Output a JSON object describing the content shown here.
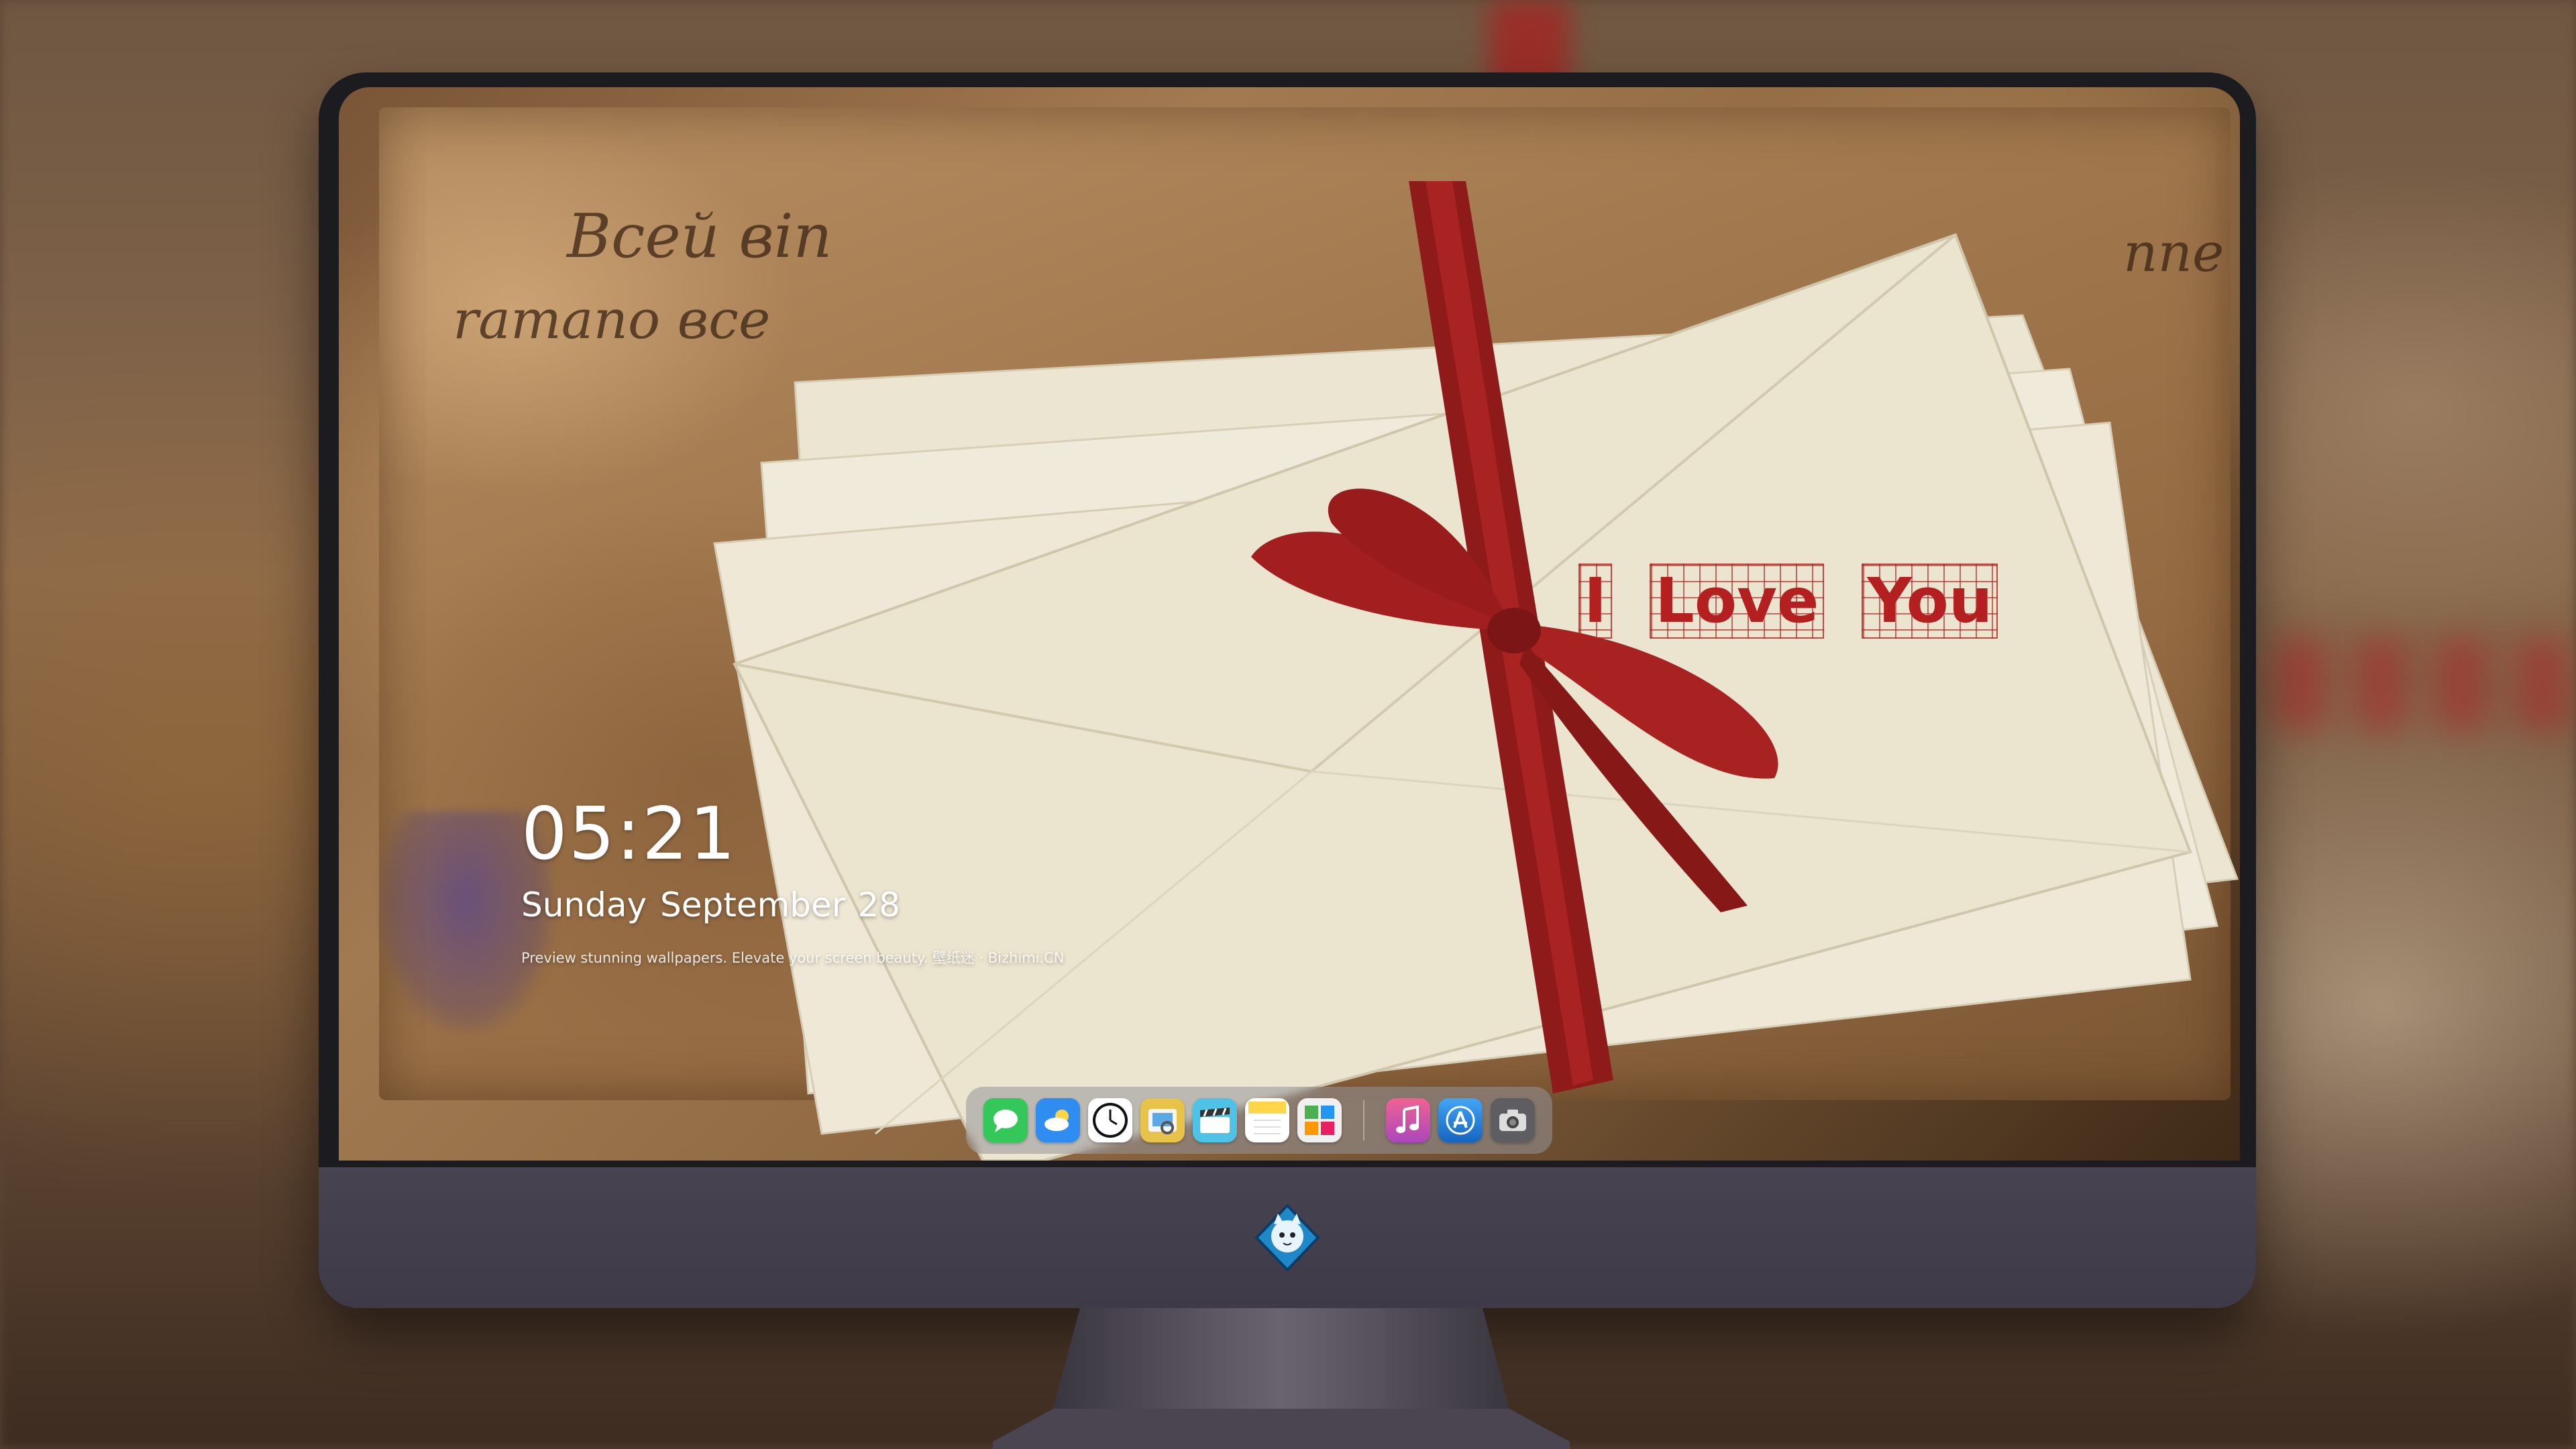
{
  "lock_screen": {
    "time": "05:21",
    "date_text": "Sunday September",
    "day_number": "28",
    "tagline": "Preview stunning wallpapers. Elevate your screen beauty. 壁纸迷 · Bizhimi.CN"
  },
  "wallpaper": {
    "love_text": [
      "I",
      "Love",
      "You"
    ],
    "script_lines": [
      "Всей віп",
      "ramano все",
      "nne"
    ]
  },
  "dock": {
    "apps": [
      {
        "name": "messages-icon",
        "color": "#34c759"
      },
      {
        "name": "weather-icon",
        "color": "#2f8cf0"
      },
      {
        "name": "clock-icon",
        "color": "#ffffff"
      },
      {
        "name": "preview-icon",
        "color": "#e8c34a"
      },
      {
        "name": "claquette-icon",
        "color": "#4fc3e6"
      },
      {
        "name": "notes-icon",
        "color": "#ffd54a"
      },
      {
        "name": "photo-gallery-icon",
        "color": "#f0f0f0"
      },
      {
        "name": "music-icon",
        "color": "#e040fb"
      },
      {
        "name": "app-store-icon",
        "color": "#1e88e5"
      },
      {
        "name": "camera-icon",
        "color": "#888888"
      }
    ]
  },
  "colors": {
    "ribbon": "#a41f1f",
    "love_text": "#b41f1f",
    "bezel": "#1c1b20",
    "chin": "#444050"
  }
}
